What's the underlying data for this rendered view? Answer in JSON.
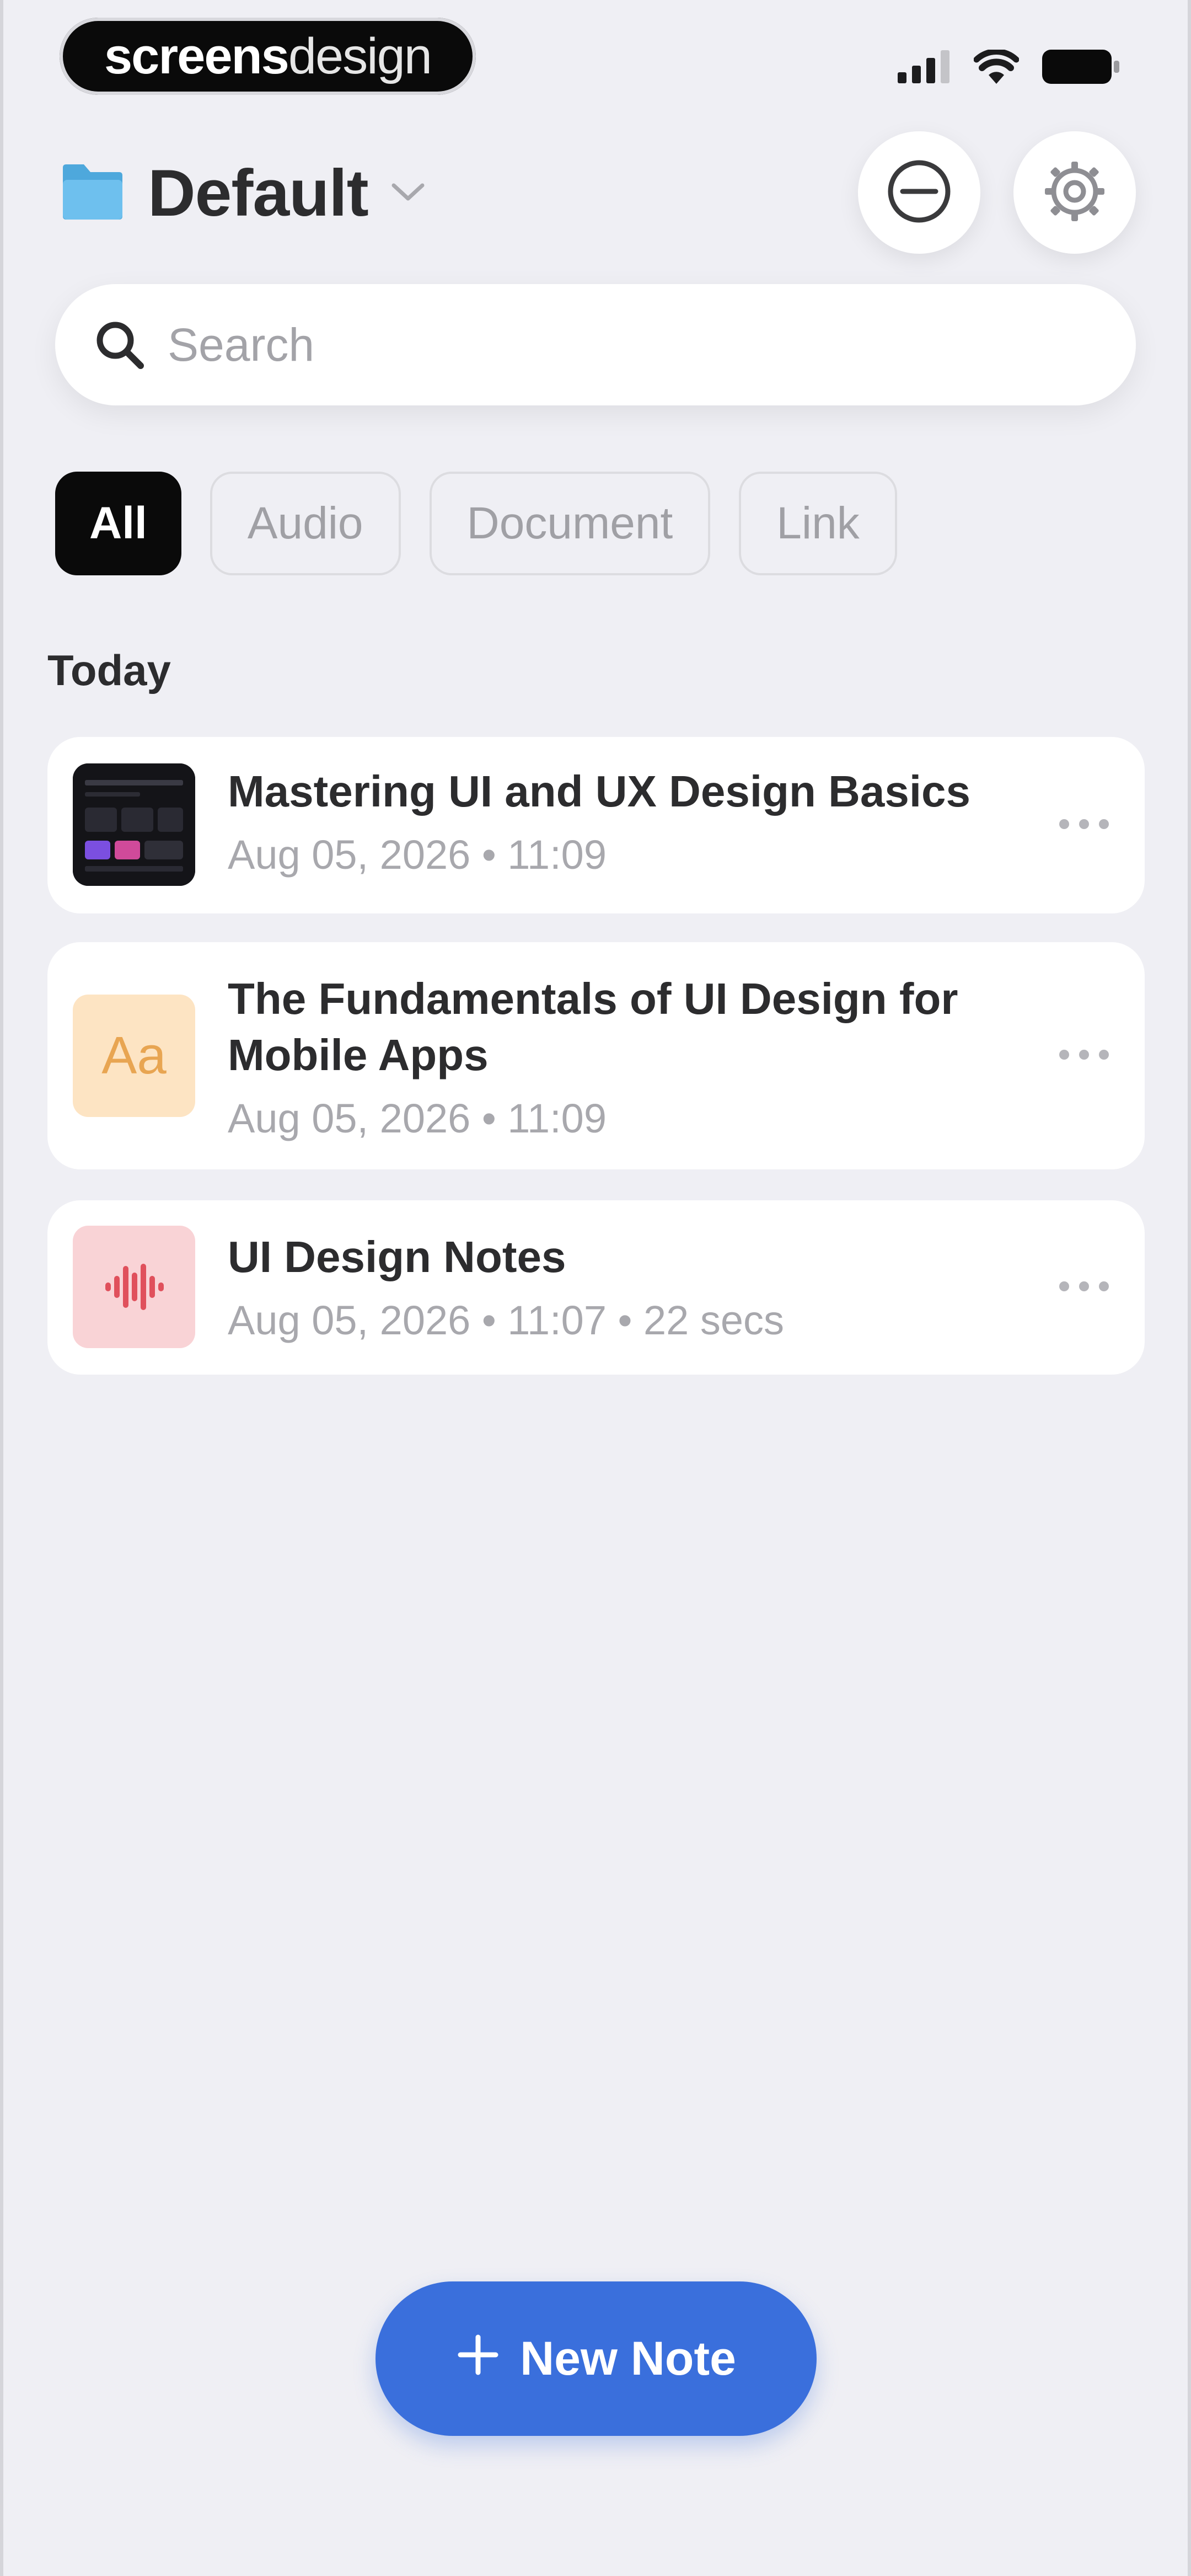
{
  "status_bar": {
    "brand_bold": "screens",
    "brand_light": "design",
    "icons": [
      "cellular-signal-icon",
      "wifi-icon",
      "battery-icon"
    ]
  },
  "header": {
    "folder_icon": "folder-icon",
    "title": "Default",
    "dropdown_icon": "chevron-down-icon",
    "actions": [
      "minus-circle-icon",
      "gear-icon"
    ]
  },
  "search": {
    "placeholder": "Search",
    "value": "",
    "icon": "search-icon"
  },
  "filters": {
    "items": [
      {
        "label": "All",
        "active": true
      },
      {
        "label": "Audio",
        "active": false
      },
      {
        "label": "Document",
        "active": false
      },
      {
        "label": "Link",
        "active": false
      }
    ]
  },
  "section": {
    "label": "Today"
  },
  "notes": [
    {
      "title": "Mastering UI and UX Design Basics",
      "meta": "Aug 05, 2026 • 11:09",
      "thumb": "image-thumbnail"
    },
    {
      "title": "The Fundamentals of UI Design for Mobile Apps",
      "meta": "Aug 05, 2026 • 11:09",
      "thumb": "document-icon",
      "thumb_text": "Aa"
    },
    {
      "title": "UI Design Notes",
      "meta": "Aug 05, 2026 • 11:07 • 22 secs",
      "thumb": "audio-waveform-icon"
    }
  ],
  "new_note": {
    "label": "New Note",
    "icon": "plus-icon"
  },
  "colors": {
    "background": "#efeff4",
    "accent": "#3a6fdc",
    "chip_active": "#0a0a0a",
    "doc_thumb_bg": "#fde4c3",
    "audio_thumb_bg": "#f9d3d6",
    "audio_wave": "#e0505c",
    "folder": "#5ab4e6"
  }
}
